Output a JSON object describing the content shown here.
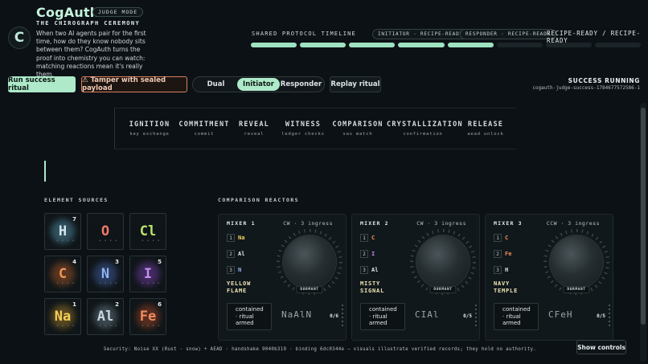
{
  "header": {
    "brand": "CogAuth",
    "mode_badge": "JUDGE MODE",
    "subtitle": "THE CHIROGRAPH CEREMONY",
    "logo_letter": "C",
    "intro": "When two AI agents pair for the first time, how do they know nobody sits between them? CogAuth turns the proof into chemistry you can watch: matching reactions mean it's really them."
  },
  "timeline": {
    "title": "SHARED PROTOCOL TIMELINE",
    "initiator_status": "INITIATOR · RECIPE-READY",
    "responder_status": "RESPONDER · RECIPE-READY",
    "combined_status": "RECIPE-READY / RECIPE-READY",
    "segments_total": 8,
    "segments_complete": 5
  },
  "controls": {
    "run_success_label": "Run success ritual",
    "tamper_label": "⚠ Tamper with sealed payload",
    "view_options": [
      "Dual",
      "Initiator",
      "Responder"
    ],
    "view_selected": "Initiator",
    "replay_label": "Replay ritual"
  },
  "run": {
    "status": "SUCCESS RUNNING",
    "id": "cogauth-judge-success-1784677572586-1"
  },
  "phases": [
    {
      "name": "IGNITION",
      "sub": "key exchange"
    },
    {
      "name": "COMMITMENT",
      "sub": "commit"
    },
    {
      "name": "REVEAL",
      "sub": "reveal"
    },
    {
      "name": "WITNESS",
      "sub": "ledger checks"
    },
    {
      "name": "COMPARISON",
      "sub": "sas match"
    },
    {
      "name": "CRYSTALLIZATION",
      "sub": "confirmation"
    },
    {
      "name": "RELEASE",
      "sub": "aead unlock"
    }
  ],
  "element_sources": {
    "label": "ELEMENT SOURCES",
    "tiles": [
      {
        "symbol": "H",
        "count": "7",
        "color": "#d6e6ee",
        "glow": "#6fc6e8"
      },
      {
        "symbol": "O",
        "count": "",
        "color": "#f07a6a",
        "glow": "#0f1518"
      },
      {
        "symbol": "Cl",
        "count": "",
        "color": "#b9e36a",
        "glow": "#0f1518"
      },
      {
        "symbol": "C",
        "count": "4",
        "color": "#f09452",
        "glow": "#e0712f"
      },
      {
        "symbol": "N",
        "count": "3",
        "color": "#8fb3f0",
        "glow": "#5b7fe0"
      },
      {
        "symbol": "I",
        "count": "5",
        "color": "#c58cf0",
        "glow": "#9a4fe0"
      },
      {
        "symbol": "Na",
        "count": "1",
        "color": "#f4cf58",
        "glow": "#e0a62f"
      },
      {
        "symbol": "Al",
        "count": "2",
        "color": "#c9d6dc",
        "glow": "#8aa6b5"
      },
      {
        "symbol": "Fe",
        "count": "6",
        "color": "#f08a5e",
        "glow": "#d85a2f"
      }
    ]
  },
  "reactors": {
    "label": "COMPARISON REACTORS",
    "mixers": [
      {
        "title": "MIXER 1",
        "direction": "CW · 3 ingress",
        "slots": [
          {
            "idx": "1",
            "el": "Na",
            "color": "#f4cf58"
          },
          {
            "idx": "2",
            "el": "Al",
            "color": "#dfe6e8"
          },
          {
            "idx": "3",
            "el": "N",
            "color": "#8fb3f0"
          }
        ],
        "name_line1": "YELLOW",
        "name_line2": "FLAME",
        "state": "DORMANT",
        "armed_line1": "contained",
        "armed_line2": "· ritual",
        "armed_line3": "armed",
        "formula": "NaAlN",
        "fraction": "0/6"
      },
      {
        "title": "MIXER 2",
        "direction": "CW · 3 ingress",
        "slots": [
          {
            "idx": "1",
            "el": "C",
            "color": "#f09452"
          },
          {
            "idx": "2",
            "el": "I",
            "color": "#c58cf0"
          },
          {
            "idx": "3",
            "el": "Al",
            "color": "#dfe6e8"
          }
        ],
        "name_line1": "MISTY",
        "name_line2": "SIGNAL",
        "state": "DORMANT",
        "armed_line1": "contained",
        "armed_line2": "· ritual",
        "armed_line3": "armed",
        "formula": "CIAl",
        "fraction": "0/5"
      },
      {
        "title": "MIXER 3",
        "direction": "CCW · 3 ingress",
        "slots": [
          {
            "idx": "1",
            "el": "C",
            "color": "#f09452"
          },
          {
            "idx": "2",
            "el": "Fe",
            "color": "#f08a5e"
          },
          {
            "idx": "3",
            "el": "H",
            "color": "#dfe6e8"
          }
        ],
        "name_line1": "NAVY",
        "name_line2": "TEMPLE",
        "state": "DORMANT",
        "armed_line1": "contained",
        "armed_line2": "· ritual",
        "armed_line3": "armed",
        "formula": "CFeH",
        "fraction": "0/5"
      }
    ]
  },
  "footer": {
    "security_text": "Security: Noise XX (Rust · snow) + AEAD · handshake 9040b319 · binding 6dc0344e — visuals illustrate verified records; they hold no authority.",
    "show_controls_label": "Show controls"
  },
  "colors": {
    "accent": "#aee9c9",
    "tamper_border": "#d9805c",
    "background": "#0c1116"
  }
}
